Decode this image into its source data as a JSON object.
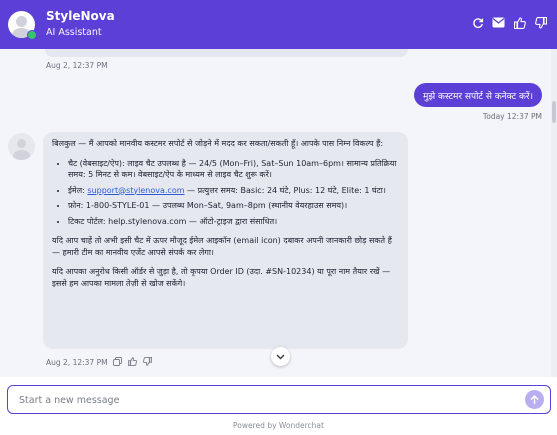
{
  "header": {
    "brand": "StyleNova",
    "subtitle": "AI Assistant",
    "icons": [
      "refresh-icon",
      "mail-icon",
      "thumbs-up-icon",
      "thumbs-down-icon"
    ],
    "accent": "#5b3fd6"
  },
  "messages": {
    "prev_time": "Aug 2, 12:37 PM",
    "user_text": "मुझे कस्टमर सपोर्ट से कनेक्ट करें।",
    "user_time": "Today 12:37 PM",
    "bot": {
      "intro": "बिलकुल — मैं आपको मानवीय कस्टमर सपोर्ट से जोड़ने में मदद कर सकता/सकती हूँ। आपके पास निम्न विकल्प हैं:",
      "items": [
        {
          "text": "चैट (वेबसाइट/ऐप): लाइव चैट उपलब्ध है — 24/5 (Mon–Fri), Sat–Sun 10am–6pm। सामान्य प्रतिक्रिया समय: 5 मिनट से कम। वेबसाइट/ऐप के माध्यम से लाइव चैट शुरू करें।"
        },
        {
          "prefix": "ईमेल: ",
          "link": "support@stylenova.com",
          "suffix": " — प्रत्युत्तर समय: Basic: 24 घंटे, Plus: 12 घंटे, Elite: 1 घंटा।"
        },
        {
          "text": "फ़ोन: 1-800-STYLE-01 — उपलब्ध Mon–Sat, 9am–8pm (स्थानीय वेयरहाउस समय)।"
        },
        {
          "text": "टिकट पोर्टल: help.stylenova.com — ऑटो-ट्राइज द्वारा संसाधित।"
        }
      ],
      "para2": "यदि आप चाहें तो अभी इसी चैट में ऊपर मौजूद ईमेल आइकॉन (email icon) दबाकर अपनी जानकारी छोड़ सकते हैं — हमारी टीम का मानवीय एजेंट आपसे संपर्क कर लेगा।",
      "para3": "यदि आपका अनुरोध किसी ऑर्डर से जुड़ा है, तो कृपया Order ID (उदा. #SN-10234) या पूरा नाम तैयार रखें — इससे हम आपका मामला तेज़ी से खोज सकेंगे।",
      "time": "Aug 2, 12:37 PM",
      "action_icons": [
        "copy-icon",
        "thumbs-up-icon",
        "thumbs-down-icon"
      ]
    }
  },
  "composer": {
    "placeholder": "Start a new message",
    "value": ""
  },
  "footer": {
    "powered": "Powered by Wonderchat"
  }
}
